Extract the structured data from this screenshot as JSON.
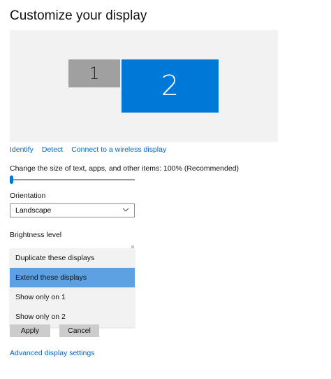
{
  "page": {
    "title": "Customize your display"
  },
  "monitors": [
    {
      "label": "1",
      "color": "#a0a0a0"
    },
    {
      "label": "2",
      "color": "#0078d7"
    }
  ],
  "links": {
    "identify": "Identify",
    "detect": "Detect",
    "wireless": "Connect to a wireless display"
  },
  "scale": {
    "label": "Change the size of text, apps, and other items: 100% (Recommended)",
    "value": 0
  },
  "orientation": {
    "label": "Orientation",
    "value": "Landscape",
    "icon": "chevron-down-icon"
  },
  "brightness": {
    "label": "Brightness level"
  },
  "multiple_displays_dropdown": {
    "options": [
      "Duplicate these displays",
      "Extend these displays",
      "Show only on 1",
      "Show only on 2"
    ],
    "selected_index": 1,
    "highlight_color": "#5da1e3"
  },
  "buttons": {
    "apply": "Apply",
    "cancel": "Cancel"
  },
  "advanced_link": "Advanced display settings",
  "accent_color": "#0078d7",
  "link_color": "#0066cc"
}
